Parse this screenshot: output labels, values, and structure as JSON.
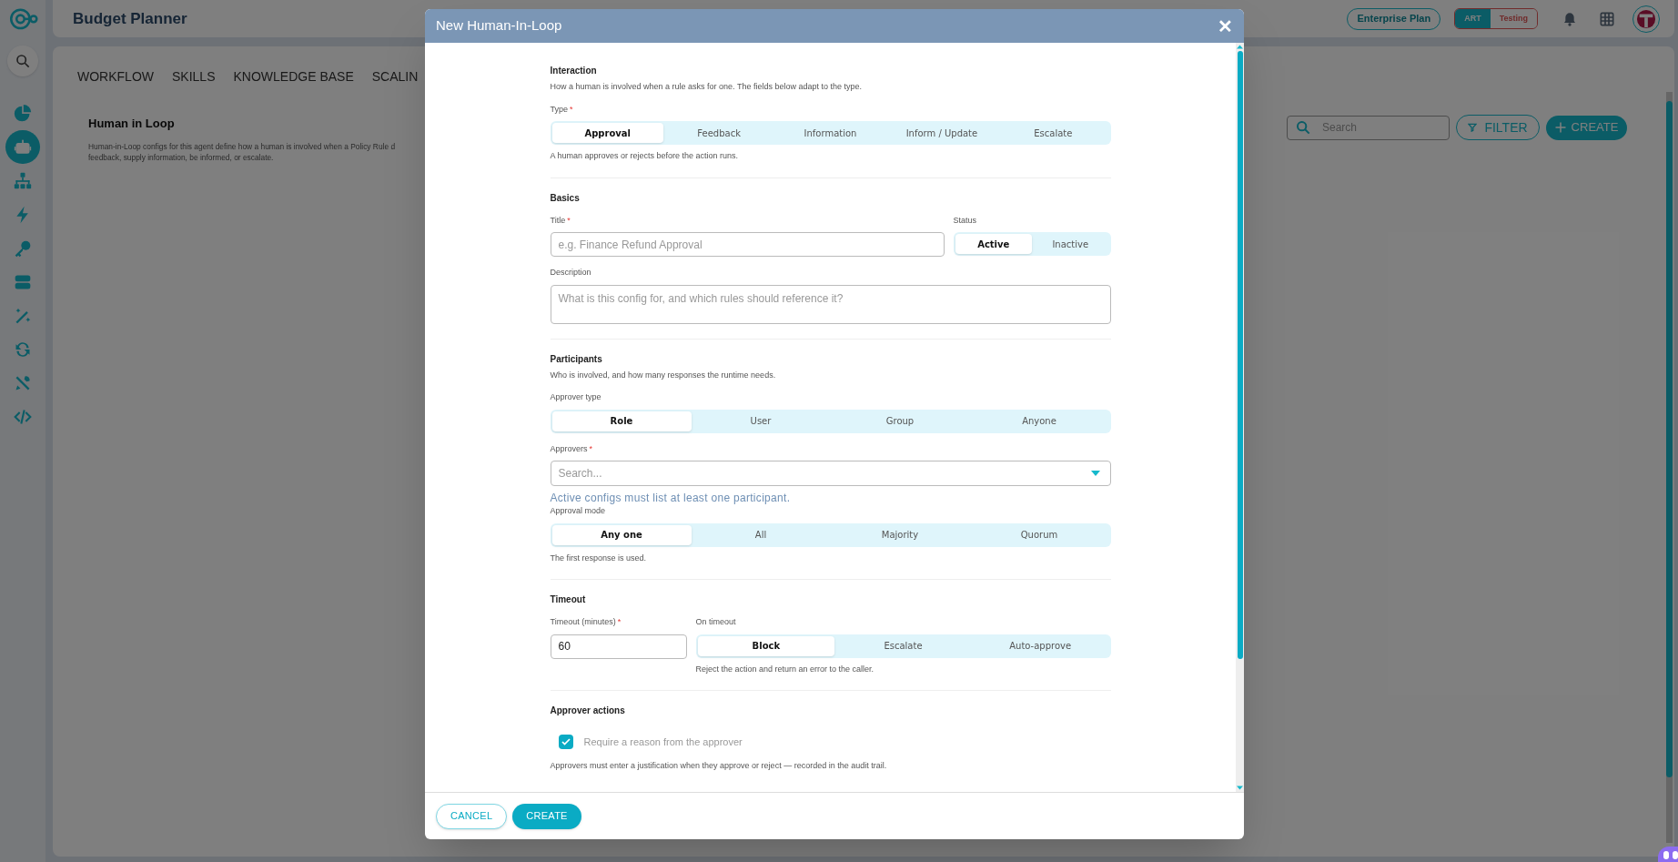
{
  "app": {
    "sidebar": {
      "items": [
        {
          "selected": false
        },
        {
          "selected": true
        },
        {
          "selected": false
        },
        {
          "selected": false
        },
        {
          "selected": false
        },
        {
          "selected": false
        },
        {
          "selected": false
        },
        {
          "selected": false
        },
        {
          "selected": false
        },
        {
          "selected": false
        }
      ]
    },
    "header": {
      "title": "Budget Planner",
      "plan": "Enterprise Plan",
      "environments": [
        {
          "label": "ART",
          "selected": true
        },
        {
          "label": "Testing",
          "selected": false
        }
      ]
    },
    "tabs": [
      {
        "label": "WORKFLOW"
      },
      {
        "label": "SKILLS"
      },
      {
        "label": "KNOWLEDGE BASE"
      },
      {
        "label": "SCALIN"
      }
    ],
    "page": {
      "title": "Human in Loop",
      "description": [
        "Human-in-Loop configs for this agent define how a human is involved when a Policy Rule d",
        "feedback, supply information, be informed, or escalate."
      ]
    },
    "toolbar": {
      "search": {
        "placeholder": "Search"
      },
      "filter": "FILTER",
      "create": "CREATE"
    }
  },
  "dialog": {
    "title": "New Human-In-Loop",
    "close": "✕",
    "sections": [
      {
        "title": "Interaction",
        "description": "How a human is involved when a rule asks for one. The fields below adapt to the type.",
        "rows": [
          [
            {
              "kind": "segmented",
              "label": "Type",
              "required_mark": "*",
              "options": [
                {
                  "label": "Approval",
                  "selected": true
                },
                {
                  "label": "Feedback",
                  "selected": false
                },
                {
                  "label": "Information",
                  "selected": false
                },
                {
                  "label": "Inform / Update",
                  "selected": false
                },
                {
                  "label": "Escalate",
                  "selected": false
                }
              ],
              "hint": "A human approves or rejects before the action runs."
            }
          ]
        ]
      },
      {
        "title": "Basics",
        "rows": [
          [
            {
              "kind": "text",
              "label": "Title",
              "required_mark": "*",
              "placeholder": "e.g. Finance Refund Approval"
            },
            {
              "kind": "segmented",
              "label": "Status",
              "options": [
                {
                  "label": "Active",
                  "selected": true
                },
                {
                  "label": "Inactive",
                  "selected": false
                }
              ]
            }
          ],
          [
            {
              "kind": "textarea",
              "label": "Description",
              "placeholder": "What is this config for, and which rules should reference it?"
            }
          ]
        ]
      },
      {
        "title": "Participants",
        "description": "Who is involved, and how many responses the runtime needs.",
        "rows": [
          [
            {
              "kind": "segmented",
              "label": "Approver type",
              "options": [
                {
                  "label": "Role",
                  "selected": true
                },
                {
                  "label": "User",
                  "selected": false
                },
                {
                  "label": "Group",
                  "selected": false
                },
                {
                  "label": "Anyone",
                  "selected": false
                }
              ]
            }
          ],
          [
            {
              "kind": "select",
              "label": "Approvers",
              "required_mark": "*",
              "placeholder": "Search...",
              "error": "Active configs must list at least one participant."
            }
          ],
          [
            {
              "kind": "segmented",
              "label": "Approval mode",
              "options": [
                {
                  "label": "Any one",
                  "selected": true
                },
                {
                  "label": "All",
                  "selected": false
                },
                {
                  "label": "Majority",
                  "selected": false
                },
                {
                  "label": "Quorum",
                  "selected": false
                }
              ],
              "hint": "The first response is used."
            }
          ]
        ]
      },
      {
        "title": "Timeout",
        "rows": [
          [
            {
              "kind": "text",
              "label": "Timeout (minutes)",
              "required_mark": "*",
              "value": "60"
            },
            {
              "kind": "segmented",
              "label": "On timeout",
              "options": [
                {
                  "label": "Block",
                  "selected": true
                },
                {
                  "label": "Escalate",
                  "selected": false
                },
                {
                  "label": "Auto-approve",
                  "selected": false
                }
              ],
              "hint": "Reject the action and return an error to the caller."
            }
          ]
        ]
      },
      {
        "title": "Approver actions",
        "rows": [
          [
            {
              "kind": "checkbox",
              "label": "Require a reason from the approver",
              "checked": true,
              "hint": "Approvers must enter a justification when they approve or reject — recorded in the audit trail."
            }
          ]
        ]
      }
    ],
    "buttons": [
      {
        "label": "CANCEL",
        "kind": "secondary"
      },
      {
        "label": "CREATE",
        "kind": "primary"
      }
    ]
  }
}
